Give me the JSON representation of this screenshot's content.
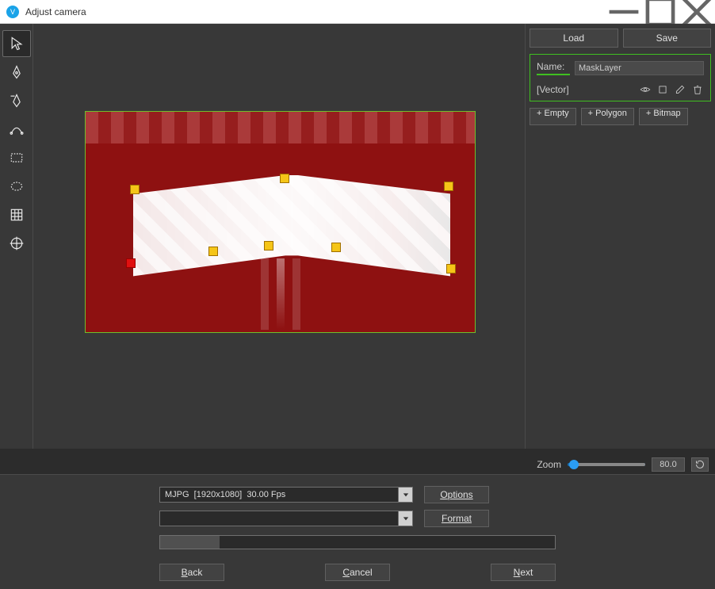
{
  "window": {
    "title": "Adjust camera"
  },
  "toolbar": {
    "tools": [
      "pointer",
      "pen",
      "pen-minus",
      "bezier",
      "rectangle",
      "ellipse",
      "grid",
      "crosshair"
    ]
  },
  "rightPanel": {
    "load": "Load",
    "save": "Save",
    "nameLabel": "Name:",
    "nameValue": "MaskLayer",
    "layerType": "[Vector]",
    "addEmpty": "+ Empty",
    "addPolygon": "+ Polygon",
    "addBitmap": "+ Bitmap"
  },
  "zoom": {
    "label": "Zoom",
    "value": "80.0"
  },
  "bottom": {
    "resolutionValue": "MJPG  [1920x1080]  30.00 Fps",
    "formatValue": "",
    "optionsBtn": "Options",
    "formatBtn": "Format",
    "backBtn": "Back",
    "cancelBtn": "Cancel",
    "nextBtn": "Next"
  }
}
